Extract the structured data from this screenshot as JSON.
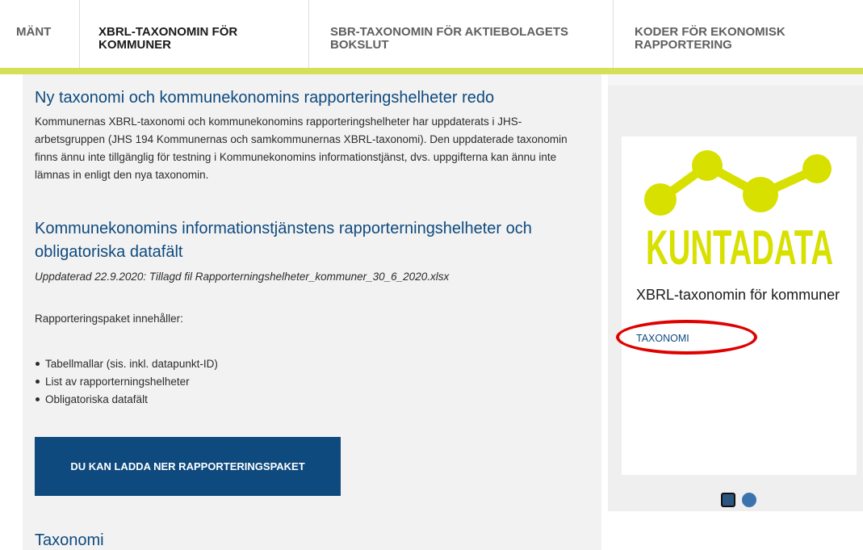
{
  "tabs": [
    {
      "label": "MÄNT"
    },
    {
      "label": "XBRL-TAXONOMIN FÖR KOMMUNER"
    },
    {
      "label": "SBR-TAXONOMIN FÖR AKTIEBOLAGETS BOKSLUT"
    },
    {
      "label": "KODER FÖR EKONOMISK RAPPORTERING"
    }
  ],
  "colors": {
    "accent": "#0e4a7e",
    "lime": "#d4e157",
    "highlight": "#e00000"
  },
  "main": {
    "news_heading": "Ny taxonomi och kommunekonomins rapporteringshelheter redo",
    "news_text": "Kommunernas XBRL-taxonomi och kommunekonomins rapporteringshelheter har uppdaterats i JHS-arbetsgruppen (JHS 194 Kommunernas och samkommunernas XBRL-taxonomi). Den uppdaterade taxonomin finns ännu inte tillgänglig för testning i Kommunekonomins informationstjänst, dvs. uppgifterna kan ännu inte lämnas in enligt den nya taxonomin.",
    "info_heading": "Kommunekonomins informationstjänstens rapporterningshelheter och obligatoriska datafält",
    "updated_text": "Uppdaterad 22.9.2020: Tillagd fil Rapporterningshelheter_kommuner_30_6_2020.xlsx",
    "package_intro": "Rapporteringspaket innehåller:",
    "package_items": [
      "Tabellmallar (sis. inkl. datapunkt-ID)",
      "List av rapporterningshelheter",
      "Obligatoriska datafält"
    ],
    "download_button": "DU KAN LADDA NER RAPPORTERINGSPAKET",
    "taxonomy_heading": "Taxonomi"
  },
  "sidebar": {
    "card": {
      "logo_text": "KUNTADATA",
      "title": "XBRL-taxonomin för kommuner",
      "tag": "TAXONOMI"
    },
    "pager": {
      "pages": 2,
      "current": 1
    }
  }
}
